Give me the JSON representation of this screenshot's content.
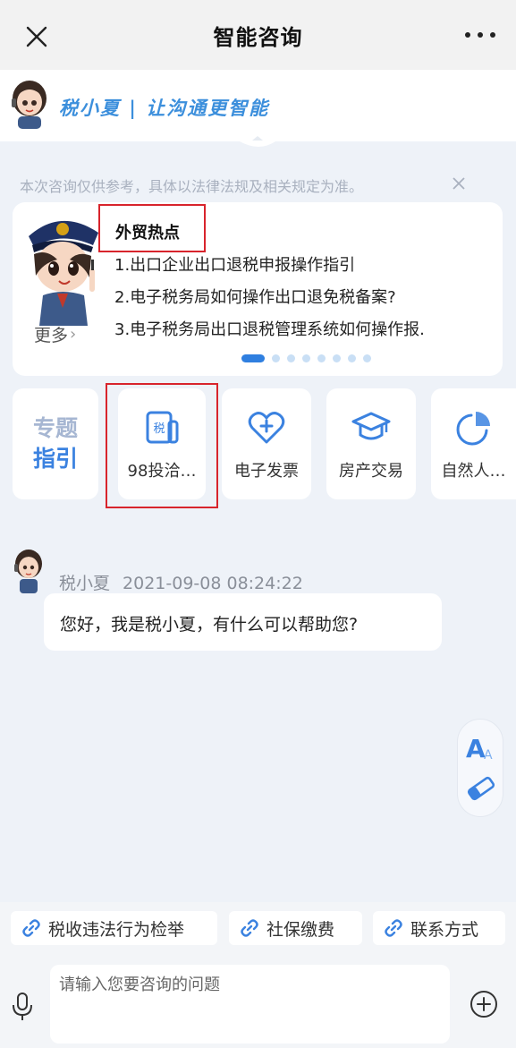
{
  "titlebar": {
    "title": "智能咨询"
  },
  "brand": {
    "slogan": "税小夏 | 让沟通更智能"
  },
  "disclaimer": "本次咨询仅供参考，具体以法律法规及相关规定为准。",
  "hot": {
    "title": "外贸热点",
    "items": [
      "1.出口企业出口退税申报操作指引",
      "2.电子税务局如何操作出口退免税备案?",
      "3.电子税务局出口退税管理系统如何操作报."
    ],
    "more_label": "更多",
    "page_count": 8,
    "active_page": 1
  },
  "topics": {
    "guide_line1": "专题",
    "guide_line2": "指引",
    "items": [
      {
        "label": "98投洽…",
        "icon": "tax-document-icon",
        "icon_text": "税"
      },
      {
        "label": "电子发票",
        "icon": "heart-plus-icon"
      },
      {
        "label": "房产交易",
        "icon": "graduation-cap-icon"
      },
      {
        "label": "自然人…",
        "icon": "pie-chart-icon"
      }
    ]
  },
  "chat": {
    "sender": "税小夏",
    "timestamp": "2021-09-08 08:24:22",
    "message": "您好，我是税小夏，有什么可以帮助您?"
  },
  "quick_links": [
    {
      "label": "税收违法行为检举",
      "icon": "link-icon"
    },
    {
      "label": "社保缴费",
      "icon": "link-icon"
    },
    {
      "label": "联系方式",
      "icon": "link-icon"
    }
  ],
  "input": {
    "placeholder": "请输入您要咨询的问题",
    "value": ""
  },
  "colors": {
    "accent": "#2f7fe0",
    "highlight_border": "#d8242c",
    "background": "#eef2f8"
  }
}
